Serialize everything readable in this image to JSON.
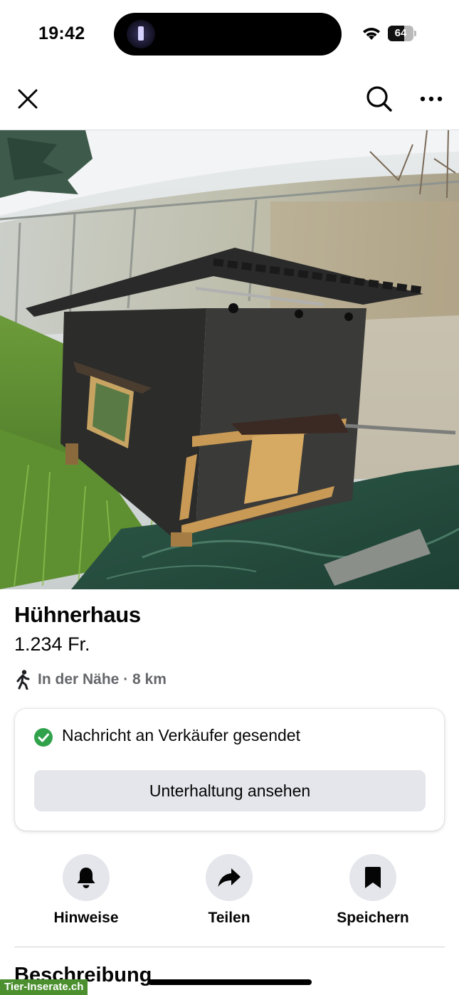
{
  "status_bar": {
    "time": "19:42",
    "battery_level": "64",
    "battery_percent": 64
  },
  "nav": {
    "close_icon": "close-icon",
    "search_icon": "search-icon",
    "more_icon": "more-horizontal-icon"
  },
  "photo": {
    "subject": "chicken-coop-photo",
    "dot_count": 7,
    "active_index": 6
  },
  "listing": {
    "title": "Hühnerhaus",
    "price": "1.234 Fr.",
    "location": "In der Nähe · 8 km"
  },
  "message_card": {
    "status_text": "Nachricht an Verkäufer gesendet",
    "button_label": "Unterhaltung ansehen",
    "status_color": "#31a24c"
  },
  "actions": [
    {
      "label": "Hinweise",
      "icon": "bell-icon"
    },
    {
      "label": "Teilen",
      "icon": "share-arrow-icon"
    },
    {
      "label": "Speichern",
      "icon": "bookmark-icon"
    }
  ],
  "section": {
    "heading": "Beschreibung"
  },
  "watermark": {
    "text": "Tier-Inserate.ch"
  }
}
